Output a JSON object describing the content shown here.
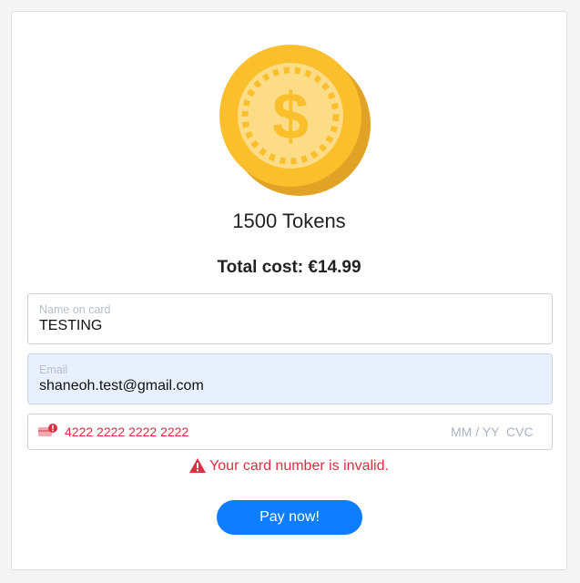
{
  "product": {
    "name": "1500 Tokens",
    "image": "gold-coin-icon"
  },
  "total": {
    "label": "Total cost: €14.99"
  },
  "form": {
    "name": {
      "label": "Name on card",
      "value": "TESTING"
    },
    "email": {
      "label": "Email",
      "value": "shaneoh.test@gmail.com"
    },
    "card": {
      "number": "4222 2222 2222 2222",
      "expiry_placeholder": "MM / YY",
      "cvc_placeholder": "CVC",
      "icon": "card-error-icon"
    }
  },
  "error": {
    "message": "Your card number is invalid.",
    "icon": "warning-icon",
    "color": "#d9303f"
  },
  "pay_button": {
    "label": "Pay now!",
    "color": "#0f7dff"
  },
  "colors": {
    "coin_outer": "#fbbf2c",
    "coin_inner": "#fddc88",
    "coin_shadow": "#e0a325",
    "autofill_bg": "#e8f0fe"
  }
}
